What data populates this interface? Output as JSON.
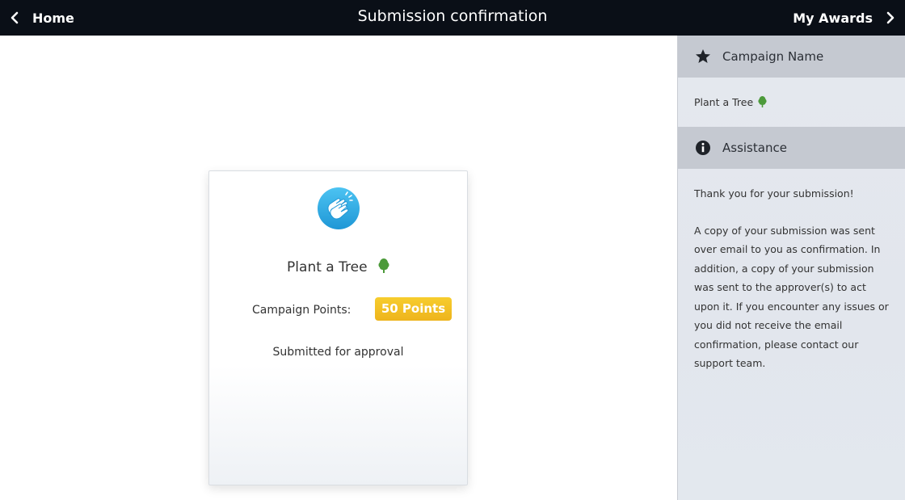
{
  "header": {
    "back_label": "Home",
    "title": "Submission confirmation",
    "forward_label": "My Awards"
  },
  "card": {
    "campaign_title": "Plant a Tree",
    "points_label": "Campaign Points:",
    "points_value": "50 Points",
    "status": "Submitted for approval"
  },
  "sidebar": {
    "campaign_section": {
      "heading": "Campaign Name",
      "value": "Plant a Tree"
    },
    "assistance_section": {
      "heading": "Assistance",
      "thanks": "Thank you for your submission!",
      "body": "A copy of your submission was sent over email to you as confirmation. In addition, a copy of your submission was sent to the approver(s) to act upon it. If you encounter any issues or you did not receive the email confirmation, please contact our support team."
    }
  },
  "icons": {
    "back": "chevron-left-icon",
    "forward": "chevron-right-icon",
    "clap": "clapping-hands-icon",
    "tree": "tree-icon",
    "star": "star-icon",
    "info": "info-icon"
  },
  "colors": {
    "topbar": "#0a0f17",
    "badge": "#f0b823",
    "clap_circle": "#2aa9e6",
    "tree": "#4c9a3a",
    "sidebar_header": "#c5c9d1"
  }
}
